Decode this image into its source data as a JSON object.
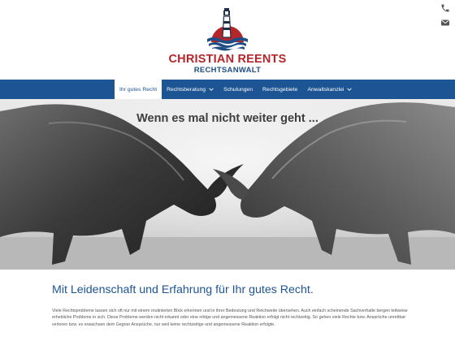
{
  "header": {
    "brand_name": "CHRISTIAN REENTS",
    "brand_subtitle": "RECHTSANWALT",
    "icons": [
      "phone-icon",
      "envelope-icon"
    ]
  },
  "nav": {
    "items": [
      {
        "label": "Ihr gutes Recht",
        "active": true,
        "dropdown": false
      },
      {
        "label": "Rechtsberatung",
        "active": false,
        "dropdown": true
      },
      {
        "label": "Schulungen",
        "active": false,
        "dropdown": false
      },
      {
        "label": "Rechtsgebiete",
        "active": false,
        "dropdown": false
      },
      {
        "label": "Anwaltskanzlei",
        "active": false,
        "dropdown": true
      }
    ]
  },
  "hero": {
    "title": "Wenn es mal nicht weiter geht ..."
  },
  "main": {
    "headline": "Mit Leidenschaft und Erfahrung für Ihr gutes Recht.",
    "intro": "Viele Rechtsprobleme lassen sich oft nur mit einem routinierten Blick erkennen und in ihrer Bedeutung und Reichweite übersehen. Auch einfach scheinende Sachverhalte bergen teilweise erhebliche Probleme in sich. Diese Probleme werden nicht erkannt oder eine nötige und angemessene Reaktion erfolgt nicht rechtzeitig. So gehen viele Rechte bzw. Ansprüche unrettbar verloren bzw. es erwachsen dem Gegner Ansprüche, nur weil keine rechtzeitige und angemessene Reaktion erfolgte."
  },
  "colors": {
    "brand_red": "#b5262b",
    "brand_blue": "#1d5493",
    "text_gray": "#555555"
  }
}
